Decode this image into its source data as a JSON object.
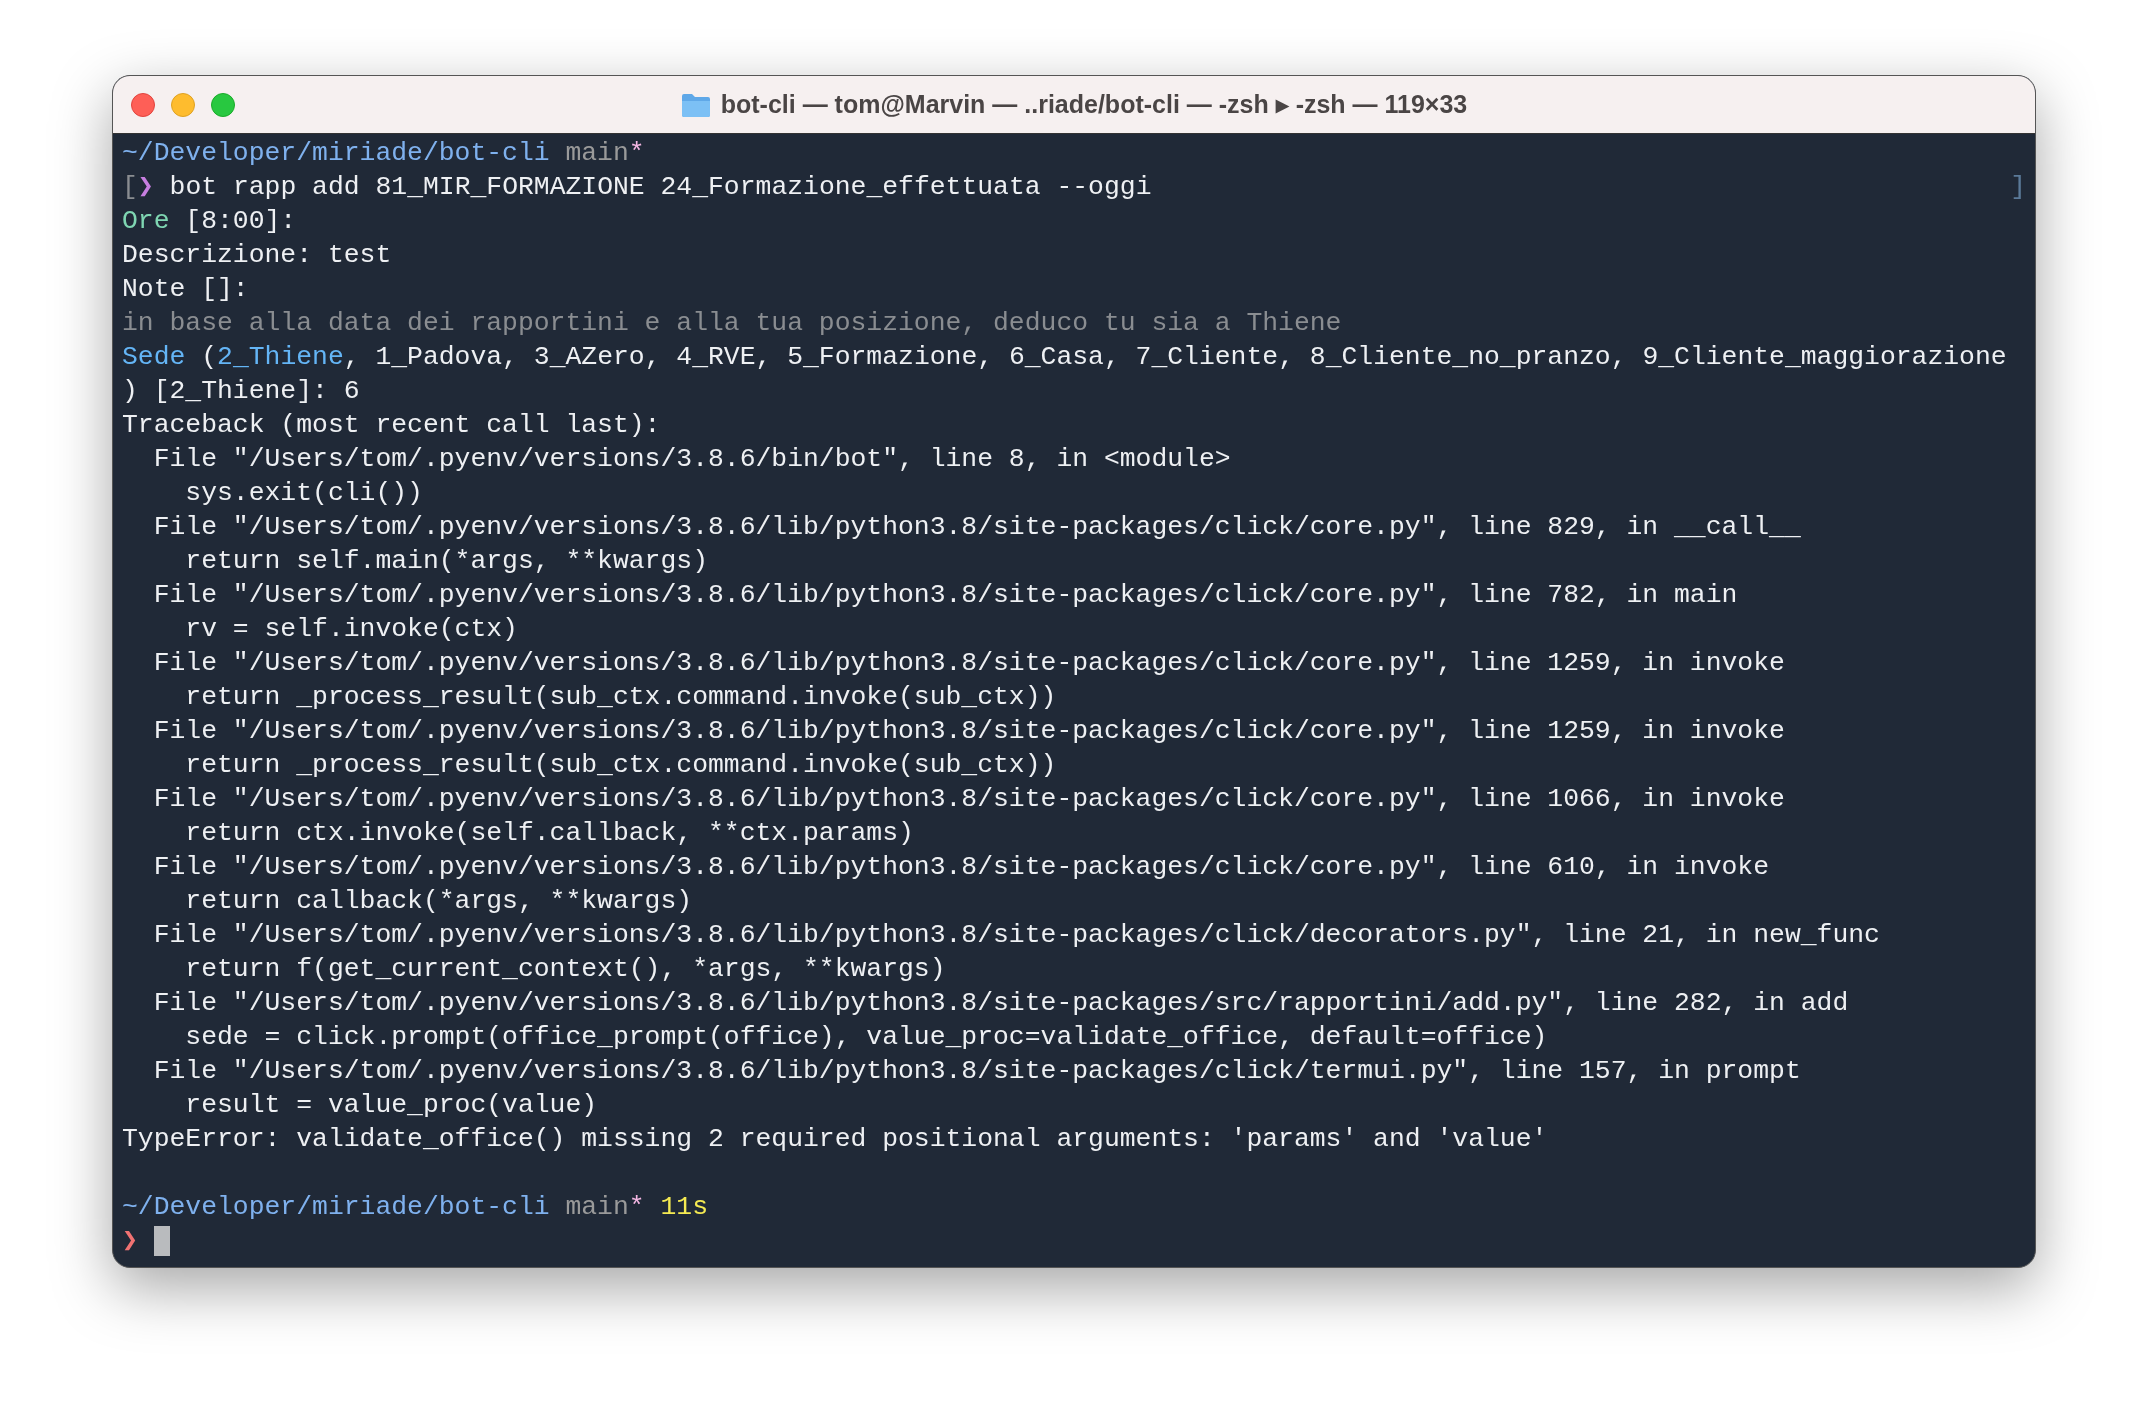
{
  "window": {
    "title": "bot-cli — tom@Marvin — ..riade/bot-cli — -zsh ▸ -zsh — 119×33"
  },
  "terminal": {
    "lines": [
      {
        "segments": [
          {
            "text": "~/Developer/miriade/bot-cli",
            "kind": "path"
          },
          {
            "text": " main",
            "kind": "branch"
          },
          {
            "text": "*",
            "kind": "star"
          }
        ]
      },
      {
        "segments": [
          {
            "text": "[",
            "kind": "dim"
          },
          {
            "text": "❯",
            "kind": "chevron"
          },
          {
            "text": " bot rapp add 81_MIR_FORMAZIONE 24_Formazione_effettuata --oggi",
            "kind": "plain"
          }
        ],
        "right": "]"
      },
      {
        "segments": [
          {
            "text": "Ore",
            "kind": "green"
          },
          {
            "text": " [8:00]:",
            "kind": "plain"
          }
        ]
      },
      {
        "segments": [
          {
            "text": "Descrizione: test",
            "kind": "plain"
          }
        ]
      },
      {
        "segments": [
          {
            "text": "Note []:",
            "kind": "plain"
          }
        ]
      },
      {
        "segments": [
          {
            "text": "in base alla data dei rapportini e alla tua posizione, deduco tu sia a Thiene",
            "kind": "dim"
          }
        ]
      },
      {
        "segments": [
          {
            "text": "Sede",
            "kind": "blue"
          },
          {
            "text": " (",
            "kind": "plain"
          },
          {
            "text": "2_Thiene",
            "kind": "blue"
          },
          {
            "text": ", 1_Padova, 3_AZero, 4_RVE, 5_Formazione, 6_Casa, 7_Cliente, 8_Cliente_no_pranzo, 9_Cliente_maggiorazione",
            "kind": "plain"
          }
        ]
      },
      {
        "segments": [
          {
            "text": ") [2_Thiene]: 6",
            "kind": "plain"
          }
        ]
      },
      {
        "segments": [
          {
            "text": "Traceback (most recent call last):",
            "kind": "plain"
          }
        ]
      },
      {
        "segments": [
          {
            "text": "  File \"/Users/tom/.pyenv/versions/3.8.6/bin/bot\", line 8, in <module>",
            "kind": "plain"
          }
        ]
      },
      {
        "segments": [
          {
            "text": "    sys.exit(cli())",
            "kind": "plain"
          }
        ]
      },
      {
        "segments": [
          {
            "text": "  File \"/Users/tom/.pyenv/versions/3.8.6/lib/python3.8/site-packages/click/core.py\", line 829, in __call__",
            "kind": "plain"
          }
        ]
      },
      {
        "segments": [
          {
            "text": "    return self.main(*args, **kwargs)",
            "kind": "plain"
          }
        ]
      },
      {
        "segments": [
          {
            "text": "  File \"/Users/tom/.pyenv/versions/3.8.6/lib/python3.8/site-packages/click/core.py\", line 782, in main",
            "kind": "plain"
          }
        ]
      },
      {
        "segments": [
          {
            "text": "    rv = self.invoke(ctx)",
            "kind": "plain"
          }
        ]
      },
      {
        "segments": [
          {
            "text": "  File \"/Users/tom/.pyenv/versions/3.8.6/lib/python3.8/site-packages/click/core.py\", line 1259, in invoke",
            "kind": "plain"
          }
        ]
      },
      {
        "segments": [
          {
            "text": "    return _process_result(sub_ctx.command.invoke(sub_ctx))",
            "kind": "plain"
          }
        ]
      },
      {
        "segments": [
          {
            "text": "  File \"/Users/tom/.pyenv/versions/3.8.6/lib/python3.8/site-packages/click/core.py\", line 1259, in invoke",
            "kind": "plain"
          }
        ]
      },
      {
        "segments": [
          {
            "text": "    return _process_result(sub_ctx.command.invoke(sub_ctx))",
            "kind": "plain"
          }
        ]
      },
      {
        "segments": [
          {
            "text": "  File \"/Users/tom/.pyenv/versions/3.8.6/lib/python3.8/site-packages/click/core.py\", line 1066, in invoke",
            "kind": "plain"
          }
        ]
      },
      {
        "segments": [
          {
            "text": "    return ctx.invoke(self.callback, **ctx.params)",
            "kind": "plain"
          }
        ]
      },
      {
        "segments": [
          {
            "text": "  File \"/Users/tom/.pyenv/versions/3.8.6/lib/python3.8/site-packages/click/core.py\", line 610, in invoke",
            "kind": "plain"
          }
        ]
      },
      {
        "segments": [
          {
            "text": "    return callback(*args, **kwargs)",
            "kind": "plain"
          }
        ]
      },
      {
        "segments": [
          {
            "text": "  File \"/Users/tom/.pyenv/versions/3.8.6/lib/python3.8/site-packages/click/decorators.py\", line 21, in new_func",
            "kind": "plain"
          }
        ]
      },
      {
        "segments": [
          {
            "text": "    return f(get_current_context(), *args, **kwargs)",
            "kind": "plain"
          }
        ]
      },
      {
        "segments": [
          {
            "text": "  File \"/Users/tom/.pyenv/versions/3.8.6/lib/python3.8/site-packages/src/rapportini/add.py\", line 282, in add",
            "kind": "plain"
          }
        ]
      },
      {
        "segments": [
          {
            "text": "    sede = click.prompt(office_prompt(office), value_proc=validate_office, default=office)",
            "kind": "plain"
          }
        ]
      },
      {
        "segments": [
          {
            "text": "  File \"/Users/tom/.pyenv/versions/3.8.6/lib/python3.8/site-packages/click/termui.py\", line 157, in prompt",
            "kind": "plain"
          }
        ]
      },
      {
        "segments": [
          {
            "text": "    result = value_proc(value)",
            "kind": "plain"
          }
        ]
      },
      {
        "segments": [
          {
            "text": "TypeError: validate_office() missing 2 required positional arguments: 'params' and 'value'",
            "kind": "plain"
          }
        ]
      },
      {
        "segments": [
          {
            "text": "~/Developer/miriade/bot-cli",
            "kind": "path"
          },
          {
            "text": " main",
            "kind": "branch"
          },
          {
            "text": "*",
            "kind": "star"
          },
          {
            "text": " 11s",
            "kind": "yellow"
          }
        ]
      },
      {
        "segments": [
          {
            "text": "❯",
            "kind": "error-chevron"
          }
        ],
        "cursor": true
      }
    ]
  }
}
